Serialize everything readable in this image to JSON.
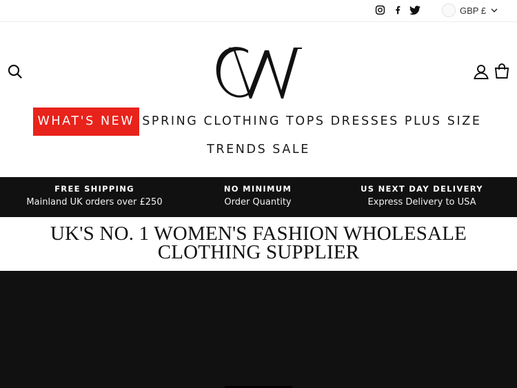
{
  "topbar": {
    "social": [
      {
        "icon": "instagram-icon"
      },
      {
        "icon": "facebook-icon"
      },
      {
        "icon": "twitter-icon"
      }
    ],
    "currency": {
      "label": "GBP £",
      "icon": "chevron-down-icon"
    }
  },
  "header": {
    "logo_text": "CW",
    "icons": [
      "search-icon",
      "account-icon",
      "cart-icon"
    ]
  },
  "nav": {
    "row1": [
      "WHAT'S NEW",
      "SPRING",
      "CLOTHING",
      "TOPS",
      "DRESSES",
      "PLUS SIZE"
    ],
    "row2": [
      "TRENDS",
      "SALE"
    ],
    "highlight_color": "#e8231b"
  },
  "announcement": [
    {
      "title": "FREE SHIPPING",
      "subtitle": "Mainland UK orders over £250"
    },
    {
      "title": "NO MINIMUM",
      "subtitle": "Order Quantity"
    },
    {
      "title": "US NEXT DAY DELIVERY",
      "subtitle": "Express Delivery to USA"
    }
  ],
  "headline": {
    "line1": "UK'S NO. 1 WOMEN'S FASHION WHOLESALE",
    "line2": "CLOTHING SUPPLIER"
  },
  "colors": {
    "announce_bg": "#111111",
    "hero_bg": "#111111",
    "accent": "#e8231b"
  }
}
